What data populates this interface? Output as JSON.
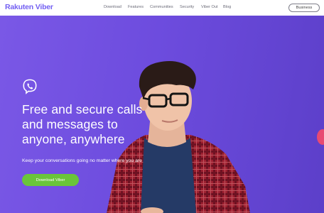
{
  "brand": {
    "logo": "Rakuten Viber"
  },
  "nav": {
    "items": [
      {
        "label": "Download"
      },
      {
        "label": "Features"
      },
      {
        "label": "Communities"
      },
      {
        "label": "Security"
      },
      {
        "label": "Viber Out"
      },
      {
        "label": "Blog"
      }
    ],
    "business_label": "Business"
  },
  "hero": {
    "headline_lines": [
      "Free and secure calls",
      "and messages to",
      "anyone, anywhere"
    ],
    "subtext": "Keep your conversations going no matter where you are",
    "download_label": "Download Viber",
    "icon": "viber-phone-icon"
  },
  "colors": {
    "brand_purple": "#7360f2",
    "hero_background": "#6b4ad8",
    "download_button": "#6ac53a",
    "text_on_hero": "#ffffff"
  }
}
